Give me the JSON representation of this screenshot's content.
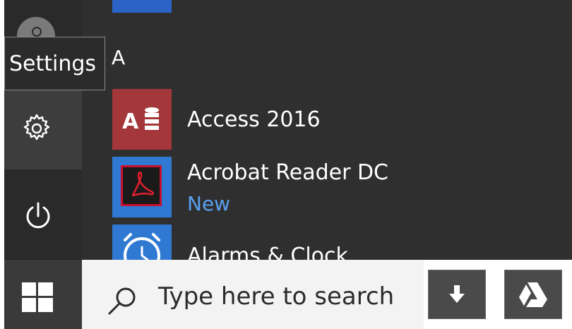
{
  "start_menu": {
    "settings_tooltip": "Settings",
    "section_letter": "A",
    "apps": [
      {
        "name": "Access 2016",
        "tile_text": "A",
        "tile_color": "#a4373a"
      },
      {
        "name": "Acrobat Reader DC",
        "badge": "New",
        "tile_color": "#2f79d3"
      },
      {
        "name": "Alarms & Clock",
        "tile_color": "#2f79d3"
      }
    ]
  },
  "taskbar": {
    "search_placeholder": "Type here to search",
    "pinned": [
      {
        "icon": "download-arrow-icon"
      },
      {
        "icon": "google-drive-icon"
      }
    ]
  },
  "icons": {
    "avatar": "user-icon",
    "settings": "gear-icon",
    "power": "power-icon",
    "start": "windows-logo-icon",
    "search": "search-icon"
  },
  "colors": {
    "menu_background": "#2f2f2f",
    "accent_blue": "#2f79d3",
    "new_badge_text": "#5aa0f0",
    "access_red": "#a4373a"
  }
}
